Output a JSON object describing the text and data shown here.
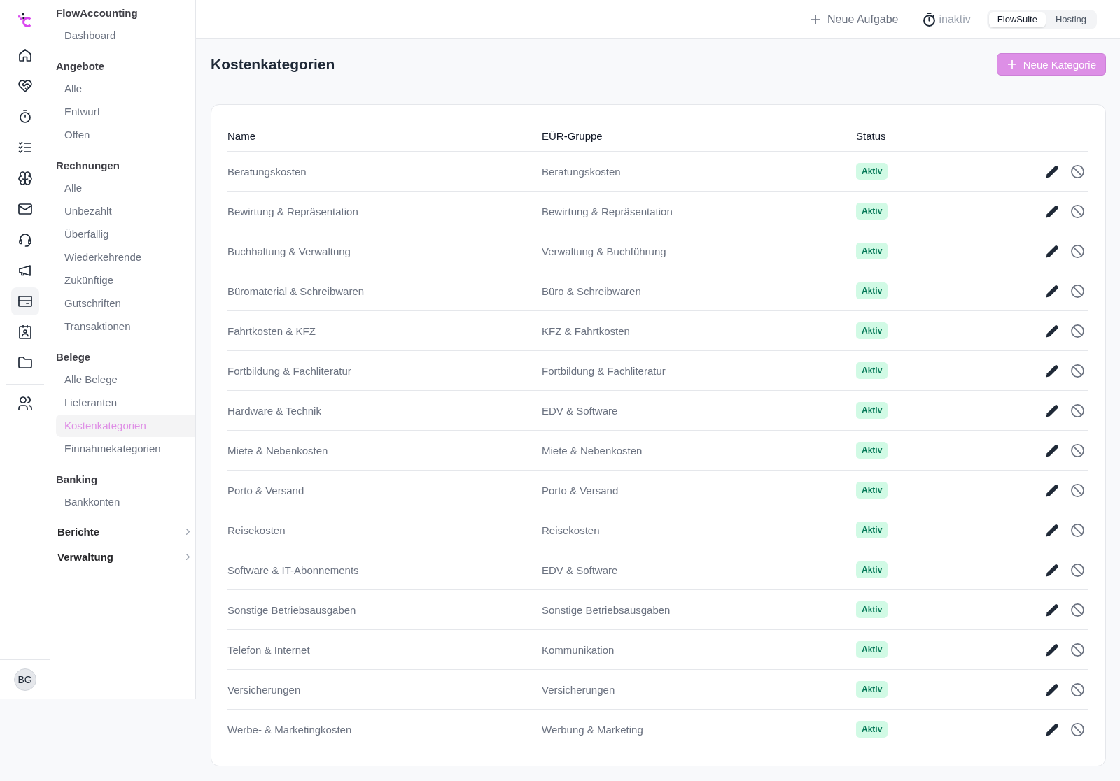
{
  "rail": {
    "main_items": [
      {
        "selected": false
      },
      {
        "selected": false
      },
      {
        "selected": false
      },
      {
        "selected": false
      },
      {
        "selected": false
      },
      {
        "selected": false
      },
      {
        "selected": false
      },
      {
        "selected": false
      },
      {
        "selected": true
      },
      {
        "selected": false
      },
      {
        "selected": false
      }
    ],
    "secondary_items": [
      {
        "selected": false
      }
    ],
    "avatar": "BG"
  },
  "sidebar": {
    "sections": [
      {
        "title": "FlowAccounting",
        "items": [
          {
            "label": "Dashboard",
            "selected": false
          }
        ]
      },
      {
        "title": "Angebote",
        "items": [
          {
            "label": "Alle",
            "selected": false
          },
          {
            "label": "Entwurf",
            "selected": false
          },
          {
            "label": "Offen",
            "selected": false
          }
        ]
      },
      {
        "title": "Rechnungen",
        "items": [
          {
            "label": "Alle",
            "selected": false
          },
          {
            "label": "Unbezahlt",
            "selected": false
          },
          {
            "label": "Überfällig",
            "selected": false
          },
          {
            "label": "Wiederkehrende",
            "selected": false
          },
          {
            "label": "Zukünftige",
            "selected": false
          },
          {
            "label": "Gutschriften",
            "selected": false
          },
          {
            "label": "Transaktionen",
            "selected": false
          }
        ]
      },
      {
        "title": "Belege",
        "items": [
          {
            "label": "Alle Belege",
            "selected": false
          },
          {
            "label": "Lieferanten",
            "selected": false
          },
          {
            "label": "Kostenkategorien",
            "selected": true
          },
          {
            "label": "Einnahmekategorien",
            "selected": false
          }
        ]
      },
      {
        "title": "Banking",
        "items": [
          {
            "label": "Bankkonten",
            "selected": false
          }
        ]
      }
    ],
    "groups": [
      {
        "label": "Berichte",
        "expanded": false
      },
      {
        "label": "Verwaltung",
        "expanded": false
      }
    ]
  },
  "topbar": {
    "new_task_button": "Neue Aufgabe",
    "timer_label": "inaktiv",
    "workspace_switch": [
      {
        "label": "FlowSuite",
        "selected": true
      },
      {
        "label": "Hosting",
        "selected": false
      }
    ]
  },
  "page": {
    "title": "Kostenkategorien",
    "primary_button": "Neue Kategorie"
  },
  "table": {
    "columns": [
      "Name",
      "EÜR-Gruppe",
      "Status"
    ],
    "rows": [
      {
        "name": "Beratungskosten",
        "group": "Beratungskosten",
        "status": "Aktiv"
      },
      {
        "name": "Bewirtung & Repräsentation",
        "group": "Bewirtung & Repräsentation",
        "status": "Aktiv"
      },
      {
        "name": "Buchhaltung & Verwaltung",
        "group": "Verwaltung & Buchführung",
        "status": "Aktiv"
      },
      {
        "name": "Büromaterial & Schreibwaren",
        "group": "Büro & Schreibwaren",
        "status": "Aktiv"
      },
      {
        "name": "Fahrtkosten & KFZ",
        "group": "KFZ & Fahrtkosten",
        "status": "Aktiv"
      },
      {
        "name": "Fortbildung & Fachliteratur",
        "group": "Fortbildung & Fachliteratur",
        "status": "Aktiv"
      },
      {
        "name": "Hardware & Technik",
        "group": "EDV & Software",
        "status": "Aktiv"
      },
      {
        "name": "Miete & Nebenkosten",
        "group": "Miete & Nebenkosten",
        "status": "Aktiv"
      },
      {
        "name": "Porto & Versand",
        "group": "Porto & Versand",
        "status": "Aktiv"
      },
      {
        "name": "Reisekosten",
        "group": "Reisekosten",
        "status": "Aktiv"
      },
      {
        "name": "Software & IT-Abonnements",
        "group": "EDV & Software",
        "status": "Aktiv"
      },
      {
        "name": "Sonstige Betriebsausgaben",
        "group": "Sonstige Betriebsausgaben",
        "status": "Aktiv"
      },
      {
        "name": "Telefon & Internet",
        "group": "Kommunikation",
        "status": "Aktiv"
      },
      {
        "name": "Versicherungen",
        "group": "Versicherungen",
        "status": "Aktiv"
      },
      {
        "name": "Werbe- & Marketingkosten",
        "group": "Werbung & Marketing",
        "status": "Aktiv"
      }
    ]
  }
}
